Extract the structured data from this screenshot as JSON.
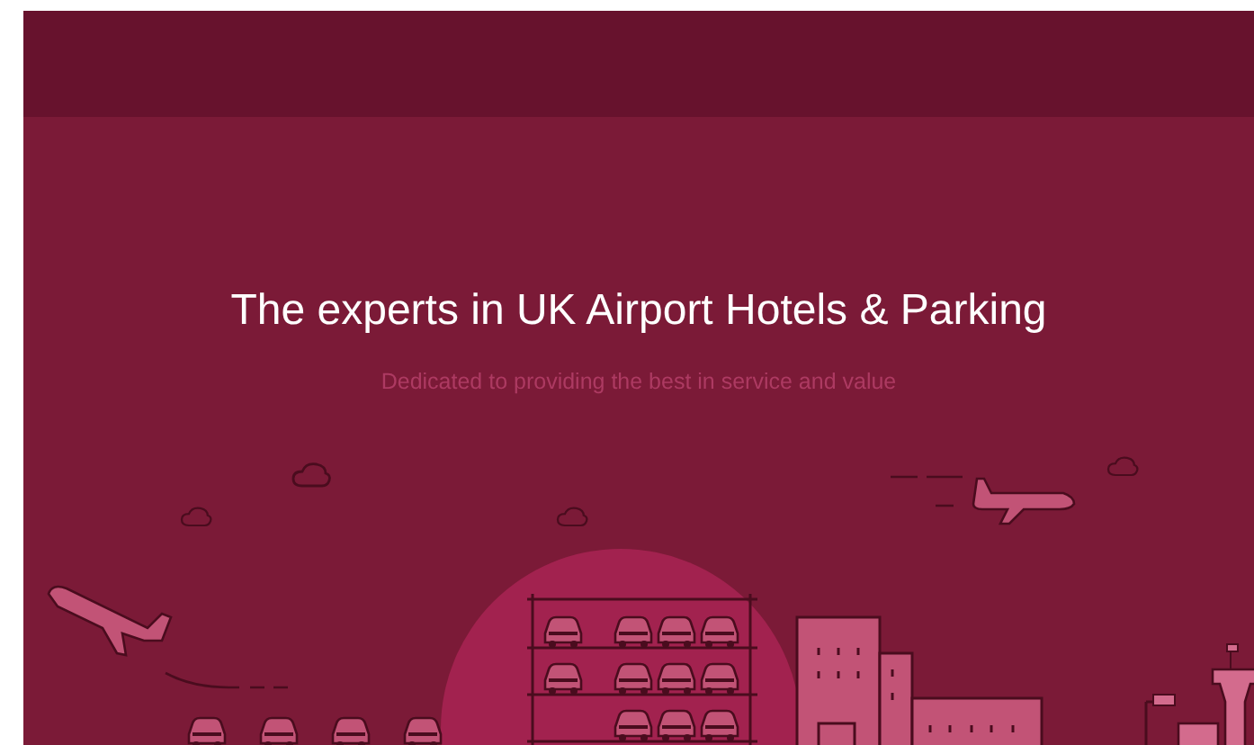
{
  "hero": {
    "title": "The experts in UK Airport Hotels & Parking",
    "subtitle": "Dedicated to providing the best in service and value"
  }
}
